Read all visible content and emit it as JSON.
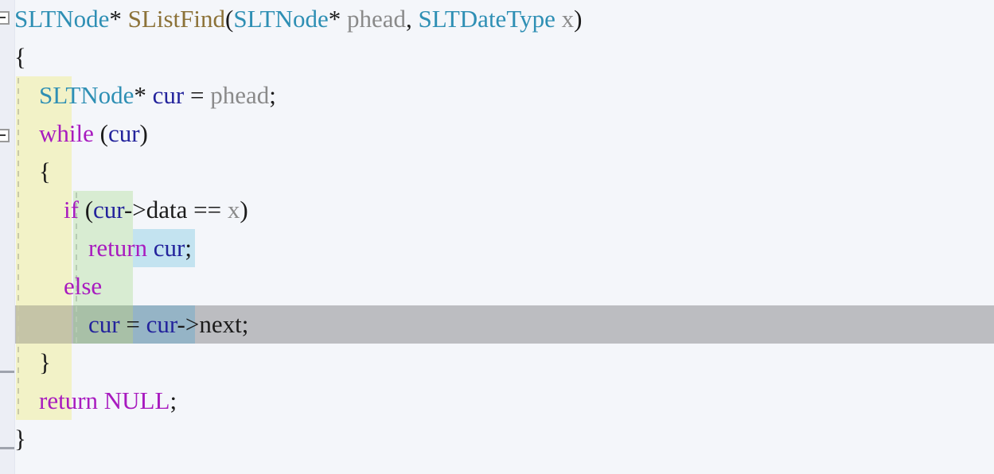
{
  "editor": {
    "language": "C",
    "background": "#f4f6fa",
    "gutter_background": "#eceef5",
    "selected_line_background": "#bcbdc1",
    "font_size_px": 31,
    "line_height_px": 48
  },
  "colors": {
    "type": "#2e8fb4",
    "function": "#8c7238",
    "keyword": "#a81bbf",
    "variable": "#23239c",
    "parameter": "#8a8a8a",
    "punctuation": "#1b1b1b",
    "indent_level1": "#f2f2c7",
    "indent_level2": "#d8ecd2",
    "indent_level3": "#c3e3f0"
  },
  "gutter": {
    "fold_markers": [
      {
        "name": "fold-marker-function",
        "line": 1,
        "state": "expanded",
        "glyph": "minus-box-icon"
      },
      {
        "name": "fold-marker-while",
        "line": 4,
        "state": "expanded",
        "glyph": "minus-box-icon"
      }
    ],
    "fold_end_markers": [
      {
        "name": "fold-end-marker-while",
        "line": 10
      },
      {
        "name": "fold-end-marker-function",
        "line": 12
      }
    ]
  },
  "code": {
    "selected_line_index": 8,
    "lines": [
      {
        "index": 0,
        "indent_level": 0,
        "tokens": [
          {
            "text": "SLTNode",
            "kind": "type"
          },
          {
            "text": "*",
            "kind": "punctuation"
          },
          {
            "text": " ",
            "kind": "plain"
          },
          {
            "text": "SListFind",
            "kind": "function"
          },
          {
            "text": "(",
            "kind": "punctuation"
          },
          {
            "text": "SLTNode",
            "kind": "type"
          },
          {
            "text": "*",
            "kind": "punctuation"
          },
          {
            "text": " ",
            "kind": "plain"
          },
          {
            "text": "phead",
            "kind": "parameter"
          },
          {
            "text": ", ",
            "kind": "punctuation"
          },
          {
            "text": "SLTDateType",
            "kind": "type"
          },
          {
            "text": " ",
            "kind": "plain"
          },
          {
            "text": "x",
            "kind": "parameter"
          },
          {
            "text": ")",
            "kind": "punctuation"
          }
        ]
      },
      {
        "index": 1,
        "indent_level": 0,
        "tokens": [
          {
            "text": "{",
            "kind": "punctuation"
          }
        ]
      },
      {
        "index": 2,
        "indent_level": 1,
        "tokens": [
          {
            "text": "    ",
            "kind": "plain"
          },
          {
            "text": "SLTNode",
            "kind": "type"
          },
          {
            "text": "*",
            "kind": "punctuation"
          },
          {
            "text": " ",
            "kind": "plain"
          },
          {
            "text": "cur",
            "kind": "variable"
          },
          {
            "text": " = ",
            "kind": "punctuation"
          },
          {
            "text": "phead",
            "kind": "parameter"
          },
          {
            "text": ";",
            "kind": "punctuation"
          }
        ]
      },
      {
        "index": 3,
        "indent_level": 1,
        "tokens": [
          {
            "text": "    ",
            "kind": "plain"
          },
          {
            "text": "while",
            "kind": "keyword"
          },
          {
            "text": " (",
            "kind": "punctuation"
          },
          {
            "text": "cur",
            "kind": "variable"
          },
          {
            "text": ")",
            "kind": "punctuation"
          }
        ]
      },
      {
        "index": 4,
        "indent_level": 1,
        "tokens": [
          {
            "text": "    ",
            "kind": "plain"
          },
          {
            "text": "{",
            "kind": "punctuation"
          }
        ]
      },
      {
        "index": 5,
        "indent_level": 2,
        "tokens": [
          {
            "text": "        ",
            "kind": "plain"
          },
          {
            "text": "if",
            "kind": "keyword"
          },
          {
            "text": " (",
            "kind": "punctuation"
          },
          {
            "text": "cur",
            "kind": "variable"
          },
          {
            "text": "->data == ",
            "kind": "punctuation"
          },
          {
            "text": "x",
            "kind": "parameter"
          },
          {
            "text": ")",
            "kind": "punctuation"
          }
        ]
      },
      {
        "index": 6,
        "indent_level": 3,
        "tokens": [
          {
            "text": "            ",
            "kind": "plain"
          },
          {
            "text": "return",
            "kind": "keyword"
          },
          {
            "text": " ",
            "kind": "plain"
          },
          {
            "text": "cur",
            "kind": "variable"
          },
          {
            "text": ";",
            "kind": "punctuation"
          }
        ]
      },
      {
        "index": 7,
        "indent_level": 2,
        "tokens": [
          {
            "text": "        ",
            "kind": "plain"
          },
          {
            "text": "else",
            "kind": "keyword"
          }
        ]
      },
      {
        "index": 8,
        "indent_level": 3,
        "selected": true,
        "tokens": [
          {
            "text": "            ",
            "kind": "plain"
          },
          {
            "text": "cur",
            "kind": "variable"
          },
          {
            "text": " = ",
            "kind": "punctuation"
          },
          {
            "text": "cur",
            "kind": "variable"
          },
          {
            "text": "->next;",
            "kind": "punctuation"
          }
        ]
      },
      {
        "index": 9,
        "indent_level": 1,
        "tokens": [
          {
            "text": "    ",
            "kind": "plain"
          },
          {
            "text": "}",
            "kind": "punctuation"
          }
        ]
      },
      {
        "index": 10,
        "indent_level": 1,
        "tokens": [
          {
            "text": "    ",
            "kind": "plain"
          },
          {
            "text": "return",
            "kind": "keyword"
          },
          {
            "text": " ",
            "kind": "plain"
          },
          {
            "text": "NULL",
            "kind": "keyword"
          },
          {
            "text": ";",
            "kind": "punctuation"
          }
        ]
      },
      {
        "index": 11,
        "indent_level": 0,
        "tokens": [
          {
            "text": "}",
            "kind": "punctuation"
          }
        ]
      }
    ]
  }
}
